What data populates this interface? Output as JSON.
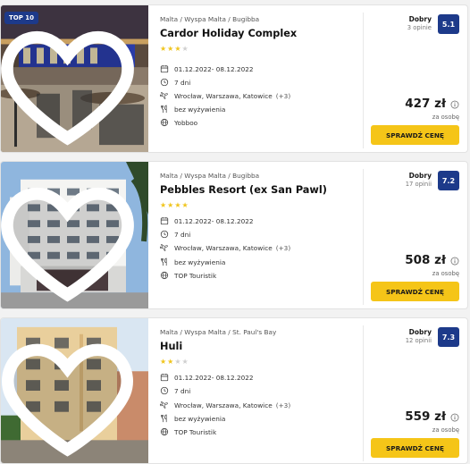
{
  "offers": [
    {
      "badge": "TOP 10",
      "location": "Malta / Wyspa Malta / Bugibba",
      "title": "Cardor Holiday Complex",
      "stars": 3,
      "dates": "01.12.2022- 08.12.2022",
      "duration": "7 dni",
      "departure": "Wrocław, Warszawa, Katowice",
      "departure_more": "(+3)",
      "board": "bez wyżywienia",
      "operator": "Yobboo",
      "rating_word": "Dobry",
      "opinions": "3 opinie",
      "score": "5.1",
      "price": "427 zł",
      "per_person": "za osobę",
      "cta": "SPRAWDŹ CENĘ"
    },
    {
      "badge": "",
      "location": "Malta / Wyspa Malta / Bugibba",
      "title": "Pebbles Resort (ex San Pawl)",
      "stars": 4,
      "dates": "01.12.2022- 08.12.2022",
      "duration": "7 dni",
      "departure": "Wrocław, Warszawa, Katowice",
      "departure_more": "(+3)",
      "board": "bez wyżywienia",
      "operator": "TOP Touristik",
      "rating_word": "Dobry",
      "opinions": "17 opinii",
      "score": "7.2",
      "price": "508 zł",
      "per_person": "za osobę",
      "cta": "SPRAWDŹ CENĘ"
    },
    {
      "badge": "",
      "location": "Malta / Wyspa Malta / St. Paul's Bay",
      "title": "Huli",
      "stars": 2,
      "dates": "01.12.2022- 08.12.2022",
      "duration": "7 dni",
      "departure": "Wrocław, Warszawa, Katowice",
      "departure_more": "(+3)",
      "board": "bez wyżywienia",
      "operator": "TOP Touristik",
      "rating_word": "Dobry",
      "opinions": "12 opinii",
      "score": "7.3",
      "price": "559 zł",
      "per_person": "za osobę",
      "cta": "SPRAWDŹ CENĘ"
    }
  ],
  "star_max": 4,
  "colors": {
    "accent_button": "#f5c518",
    "score_badge": "#1d3a8a",
    "star": "#f0c51d"
  },
  "icons": [
    "heart-icon",
    "calendar-icon",
    "clock-icon",
    "plane-icon",
    "meal-icon",
    "globe-icon",
    "info-icon"
  ]
}
